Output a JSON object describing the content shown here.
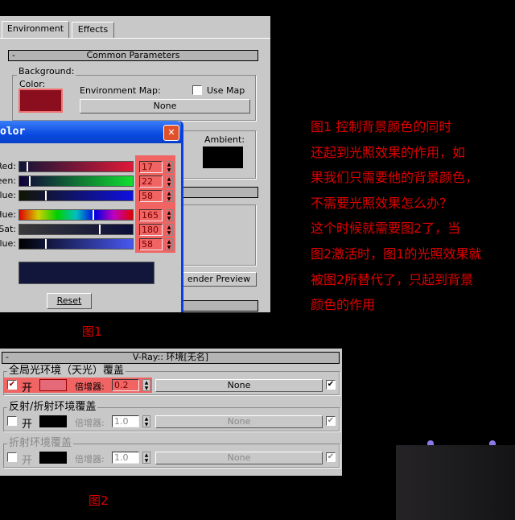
{
  "fig1": {
    "tabs": [
      "Environment",
      "Effects"
    ],
    "rollout_title": "Common Parameters",
    "rollout_toggle": "-",
    "background_group": "Background:",
    "color_label": "Color:",
    "bg_color": "#8a0e1e",
    "env_map_label": "Environment Map:",
    "use_map_label": "Use Map",
    "none_button": "None",
    "ambient_label": "Ambient:",
    "ambient_color": "#000000",
    "render_preview": "ender Preview",
    "caption": "图1"
  },
  "color_dialog": {
    "title": "olor",
    "rows": [
      {
        "label": "Red:",
        "value": "17",
        "max": 255
      },
      {
        "label": "een:",
        "value": "22",
        "max": 255
      },
      {
        "label": "Blue:",
        "value": "58",
        "max": 255
      },
      {
        "label": "Hue:",
        "value": "165",
        "max": 255
      },
      {
        "label": "Sat:",
        "value": "180",
        "max": 255
      },
      {
        "label": "alue:",
        "value": "58",
        "max": 255
      }
    ],
    "preview_color": "#11163a",
    "reset_button": "Reset",
    "highlight_color": "#f06464"
  },
  "fig2": {
    "title": "V-Ray:: 环境[无名]",
    "toggle": "-",
    "groups": [
      {
        "label": "全局光环境（天光）覆盖",
        "on": "开",
        "checked": true,
        "mult_label": "倍增器:",
        "mult": "0.2",
        "map": "None",
        "map_checked": true,
        "swatch": "#e46a7a",
        "enabled": true
      },
      {
        "label": "反射/折射环境覆盖",
        "on": "开",
        "checked": false,
        "mult_label": "倍增器:",
        "mult": "1.0",
        "map": "None",
        "map_checked": true,
        "swatch": "#000000",
        "enabled": false
      },
      {
        "label": "折射环境覆盖",
        "on": "开",
        "checked": false,
        "mult_label": "倍增器:",
        "mult": "1.0",
        "map": "None",
        "map_checked": true,
        "swatch": "#000000",
        "enabled": false
      }
    ],
    "caption": "图2"
  },
  "notes": [
    "图1 控制背景颜色的同时",
    "还起到光照效果的作用，如",
    "果我们只需要他的背景颜色，",
    "不需要光照效果怎么办？",
    "  这个时候就需要图2了，当",
    "图2激活时，图1的光照效果就",
    "被图2所替代了，只起到背景",
    "颜色的作用"
  ]
}
